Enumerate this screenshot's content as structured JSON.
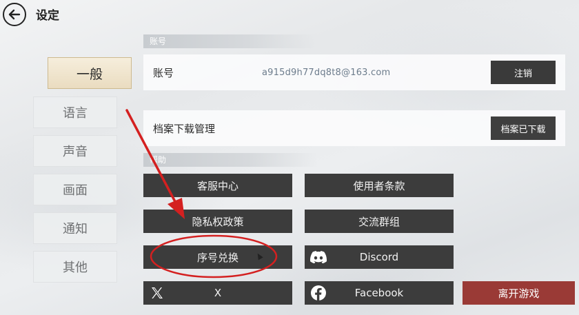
{
  "header": {
    "title": "设定",
    "back_icon": "back-arrow-icon"
  },
  "menu": {
    "items": [
      {
        "label": "一般",
        "active": true
      },
      {
        "label": "语言",
        "active": false
      },
      {
        "label": "声音",
        "active": false
      },
      {
        "label": "画面",
        "active": false
      },
      {
        "label": "通知",
        "active": false
      },
      {
        "label": "其他",
        "active": false
      }
    ]
  },
  "account_section": {
    "header": "账号",
    "account_label": "账号",
    "account_value": "a915d9h77dq8t8@163.com",
    "logout_button": "注销",
    "archive_label": "档案下载管理",
    "archive_button": "档案已下载"
  },
  "help_section": {
    "header": "帮助",
    "buttons": {
      "customer_service": "客服中心",
      "terms_of_use": "使用者条款",
      "privacy_policy": "隐私权政策",
      "community_group": "交流群组",
      "redeem_code": "序号兑换",
      "discord": "Discord",
      "x": "X",
      "facebook": "Facebook"
    },
    "exit_button": "离开游戏"
  },
  "colors": {
    "annotation_red": "#d42020",
    "exit_button": "#9a3a36",
    "dark_button": "#3c3c3c",
    "active_tab": "#eadcc0"
  }
}
